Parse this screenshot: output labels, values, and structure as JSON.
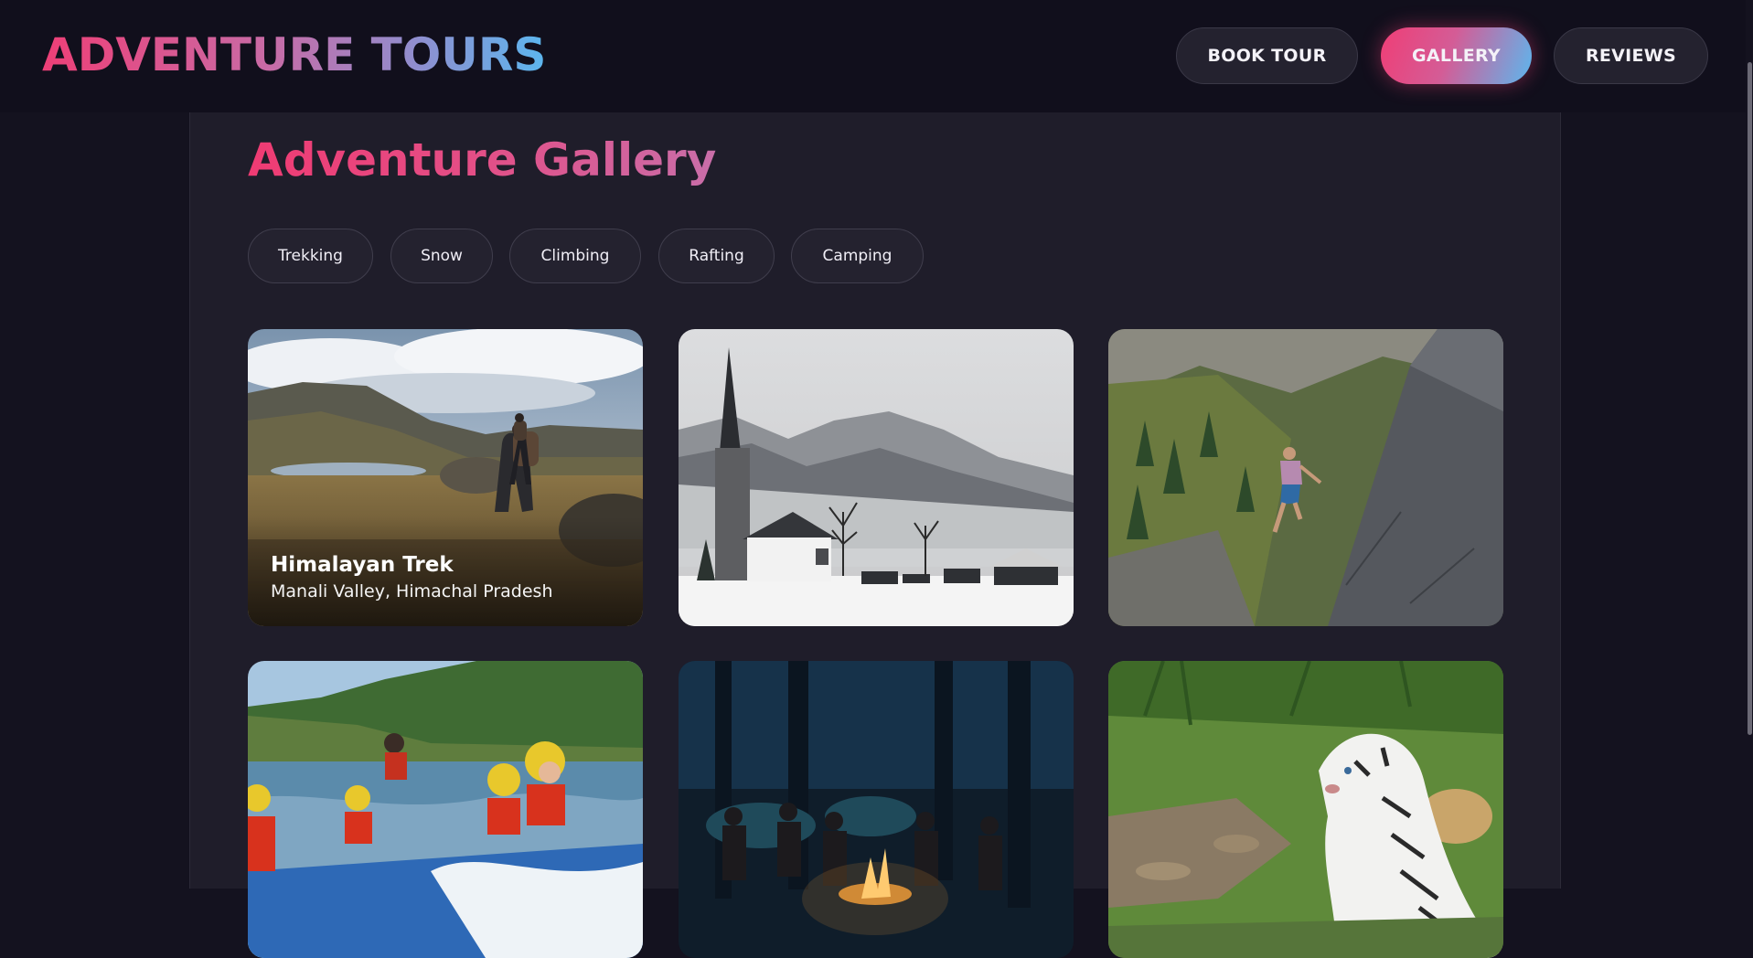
{
  "header": {
    "logo": "ADVENTURE TOURS",
    "nav": [
      {
        "label": "BOOK TOUR",
        "active": false
      },
      {
        "label": "GALLERY",
        "active": true
      },
      {
        "label": "REVIEWS",
        "active": false
      }
    ]
  },
  "gallery": {
    "title": "Adventure Gallery",
    "filters": [
      "Trekking",
      "Snow",
      "Climbing",
      "Rafting",
      "Camping"
    ],
    "items": [
      {
        "title": "Himalayan Trek",
        "location": "Manali Valley, Himachal Pradesh",
        "image": "trekking-photo"
      },
      {
        "image": "snowy-church-photo"
      },
      {
        "image": "rock-climbing-photo"
      },
      {
        "image": "river-rafting-photo"
      },
      {
        "image": "campfire-photo"
      },
      {
        "image": "white-tiger-photo"
      }
    ]
  },
  "colors": {
    "background": "#14121f",
    "panel": "#1f1d2a",
    "accent_pink": "#ef3e76",
    "accent_blue": "#5cb7ee",
    "chip": "#24222f"
  }
}
